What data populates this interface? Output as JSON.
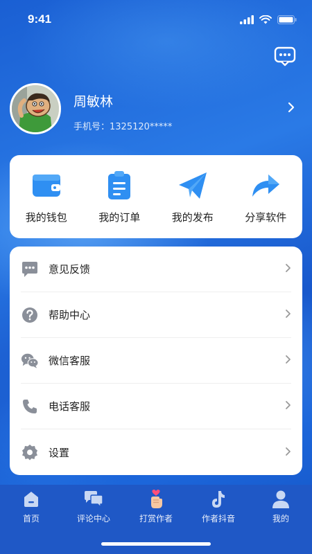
{
  "status_bar": {
    "time": "9:41"
  },
  "profile": {
    "name": "周敏林",
    "phone": "手机号：1325120*****"
  },
  "quick_actions": [
    {
      "label": "我的钱包",
      "icon": "wallet-icon"
    },
    {
      "label": "我的订单",
      "icon": "clipboard-icon"
    },
    {
      "label": "我的发布",
      "icon": "paper-plane-icon"
    },
    {
      "label": "分享软件",
      "icon": "share-arrow-icon"
    }
  ],
  "menu": [
    {
      "label": "意见反馈",
      "icon": "feedback-icon"
    },
    {
      "label": "帮助中心",
      "icon": "help-icon"
    },
    {
      "label": "微信客服",
      "icon": "wechat-icon"
    },
    {
      "label": "电话客服",
      "icon": "phone-icon"
    },
    {
      "label": "设置",
      "icon": "settings-icon"
    }
  ],
  "tabbar": [
    {
      "label": "首页",
      "icon": "home-icon"
    },
    {
      "label": "评论中心",
      "icon": "comments-icon"
    },
    {
      "label": "打赏作者",
      "icon": "heart-hand-icon"
    },
    {
      "label": "作者抖音",
      "icon": "tiktok-icon"
    },
    {
      "label": "我的",
      "icon": "user-icon"
    }
  ],
  "colors": {
    "primary": "#1f58c6",
    "accent_icon": "#2b8ff0",
    "menu_icon": "#8a8f99"
  }
}
